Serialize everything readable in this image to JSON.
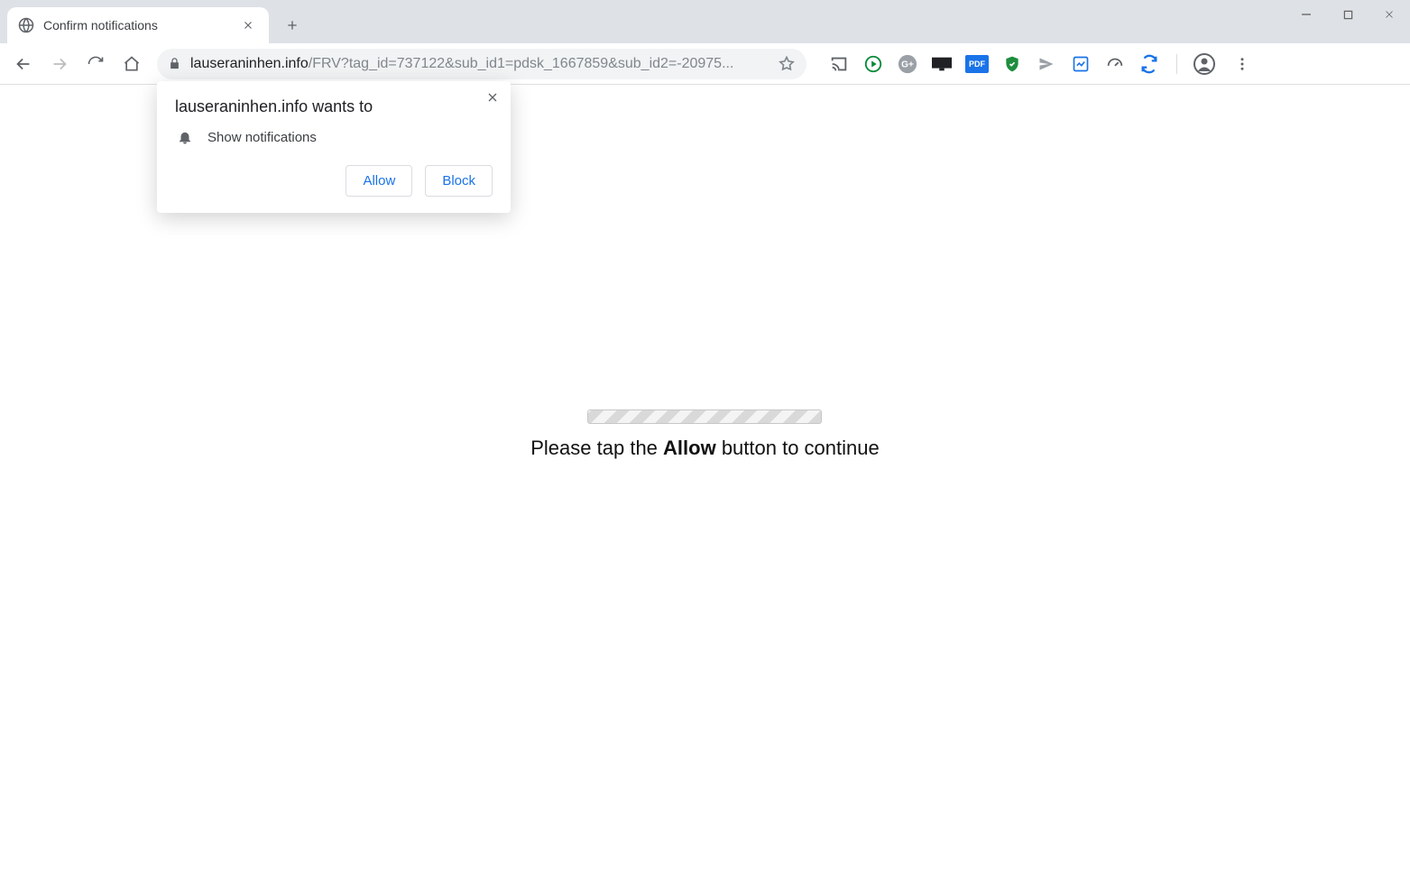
{
  "window": {
    "tab_title": "Confirm notifications"
  },
  "address": {
    "host": "lauseraninhen.info",
    "path": "/FRV?tag_id=737122&sub_id1=pdsk_1667859&sub_id2=-20975..."
  },
  "permission_popup": {
    "title": "lauseraninhen.info wants to",
    "permission_label": "Show notifications",
    "allow_label": "Allow",
    "block_label": "Block"
  },
  "page": {
    "prompt_prefix": "Please tap the ",
    "prompt_bold": "Allow",
    "prompt_suffix": " button to continue"
  },
  "extensions": {
    "pdf_label": "PDF"
  }
}
